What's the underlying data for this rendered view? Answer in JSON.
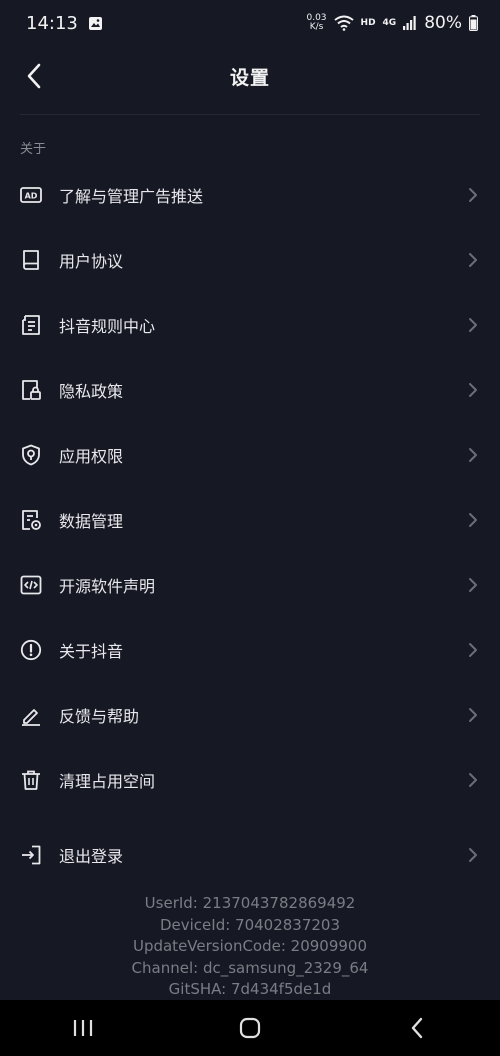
{
  "status_bar": {
    "time": "14:13",
    "speed_value": "0.03",
    "speed_unit": "K/s",
    "network_label": "HD",
    "network_type": "4G",
    "battery": "80%"
  },
  "header": {
    "title": "设置"
  },
  "section": {
    "label": "关于"
  },
  "menu": {
    "items": [
      {
        "label": "了解与管理广告推送",
        "icon": "ad-icon"
      },
      {
        "label": "用户协议",
        "icon": "book-icon"
      },
      {
        "label": "抖音规则中心",
        "icon": "document-list-icon"
      },
      {
        "label": "隐私政策",
        "icon": "privacy-lock-icon"
      },
      {
        "label": "应用权限",
        "icon": "shield-icon"
      },
      {
        "label": "数据管理",
        "icon": "data-gear-icon"
      },
      {
        "label": "开源软件声明",
        "icon": "code-icon"
      },
      {
        "label": "关于抖音",
        "icon": "info-alert-icon"
      },
      {
        "label": "反馈与帮助",
        "icon": "edit-icon"
      },
      {
        "label": "清理占用空间",
        "icon": "trash-icon"
      }
    ],
    "logout": {
      "label": "退出登录",
      "icon": "logout-icon"
    }
  },
  "info": {
    "user_id": "UserId: 2137043782869492",
    "device_id": "DeviceId: 70402837203",
    "update_version": "UpdateVersionCode: 20909900",
    "channel": "Channel: dc_samsung_2329_64",
    "git_sha": "GitSHA: 7d434f5de1d"
  }
}
